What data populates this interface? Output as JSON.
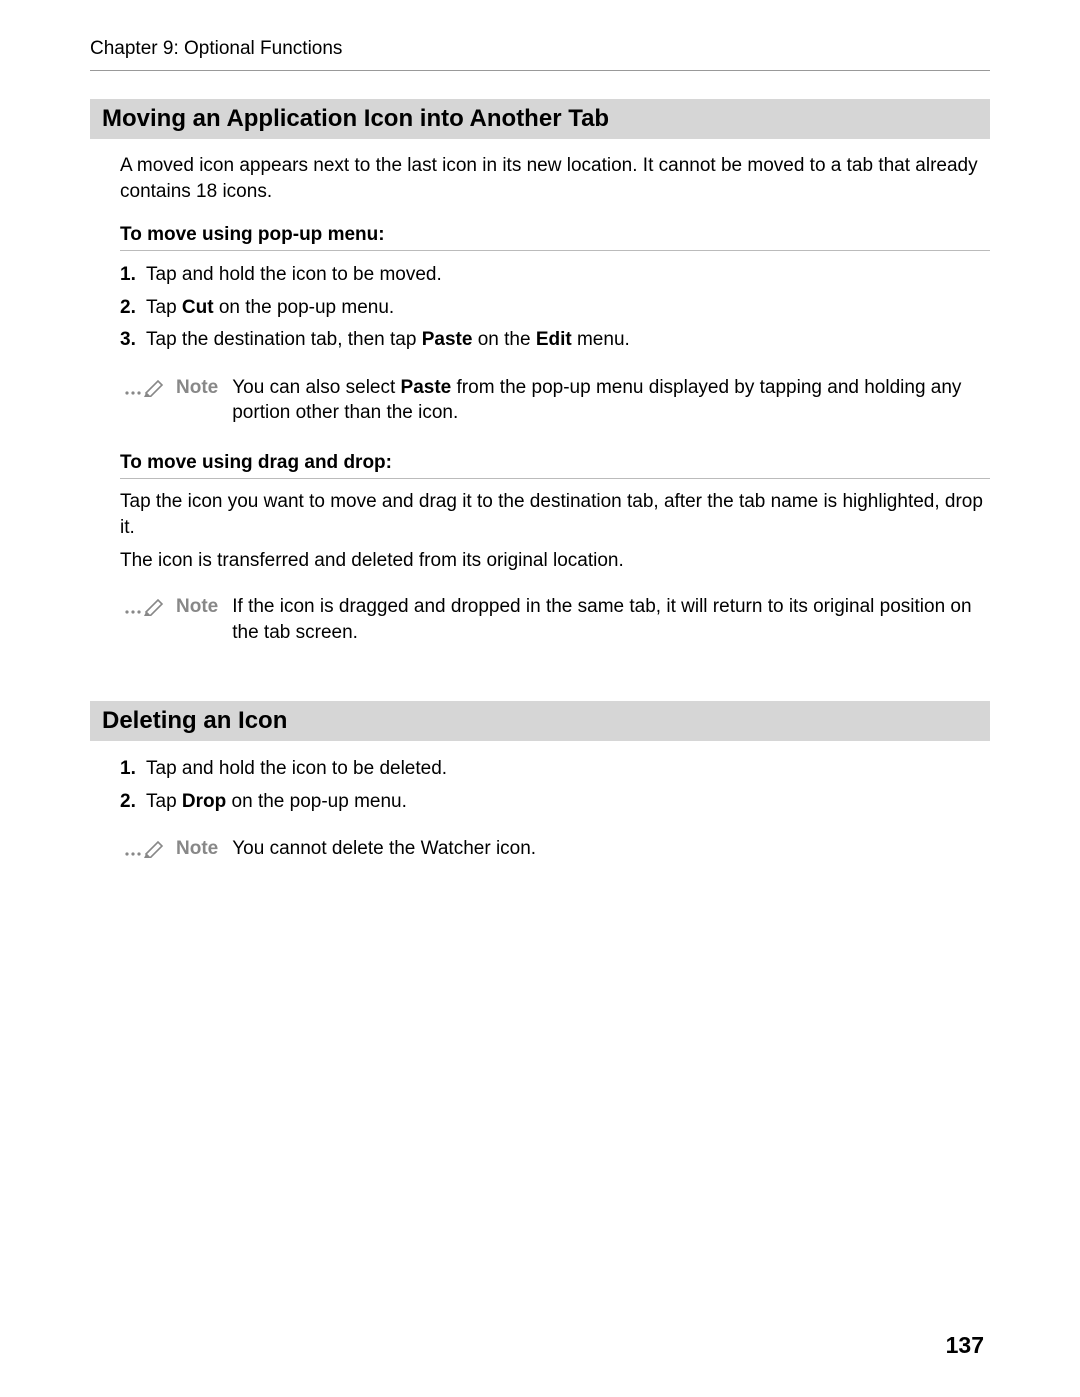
{
  "running_head": "Chapter 9: Optional Functions",
  "page_number": "137",
  "section1": {
    "title": "Moving an Application Icon into Another Tab",
    "intro": "A moved icon appears next to the last icon in its new location. It cannot be moved to a tab that already contains 18 icons.",
    "sub1": {
      "title": "To move using pop-up menu:",
      "steps": [
        {
          "num": "1.",
          "pre": "Tap and hold the icon to be moved.",
          "bold": "",
          "post": ""
        },
        {
          "num": "2.",
          "pre": "Tap ",
          "bold": "Cut",
          "post": " on the pop-up menu."
        },
        {
          "num": "3.",
          "pre": "Tap the destination tab, then tap ",
          "bold": "Paste",
          "post": " on the ",
          "bold2": "Edit",
          "post2": " menu."
        }
      ],
      "note": {
        "label": "Note",
        "pre": "You can also select ",
        "bold": "Paste",
        "post": " from the pop-up menu displayed by tapping and holding any portion other than the icon."
      }
    },
    "sub2": {
      "title": "To move using drag and drop:",
      "para1": "Tap the icon you want to move and drag it to the destination tab, after the tab name is highlighted, drop it.",
      "para2": "The icon is transferred and deleted from its original location.",
      "note": {
        "label": "Note",
        "pre": "If the icon is dragged and dropped in the same tab, it will return to its original position on the tab screen.",
        "bold": "",
        "post": ""
      }
    }
  },
  "section2": {
    "title": "Deleting an Icon",
    "steps": [
      {
        "num": "1.",
        "pre": "Tap and hold the icon to be deleted.",
        "bold": "",
        "post": ""
      },
      {
        "num": "2.",
        "pre": "Tap ",
        "bold": "Drop",
        "post": " on the pop-up menu."
      }
    ],
    "note": {
      "label": "Note",
      "pre": "You cannot delete the Watcher icon.",
      "bold": "",
      "post": ""
    }
  }
}
